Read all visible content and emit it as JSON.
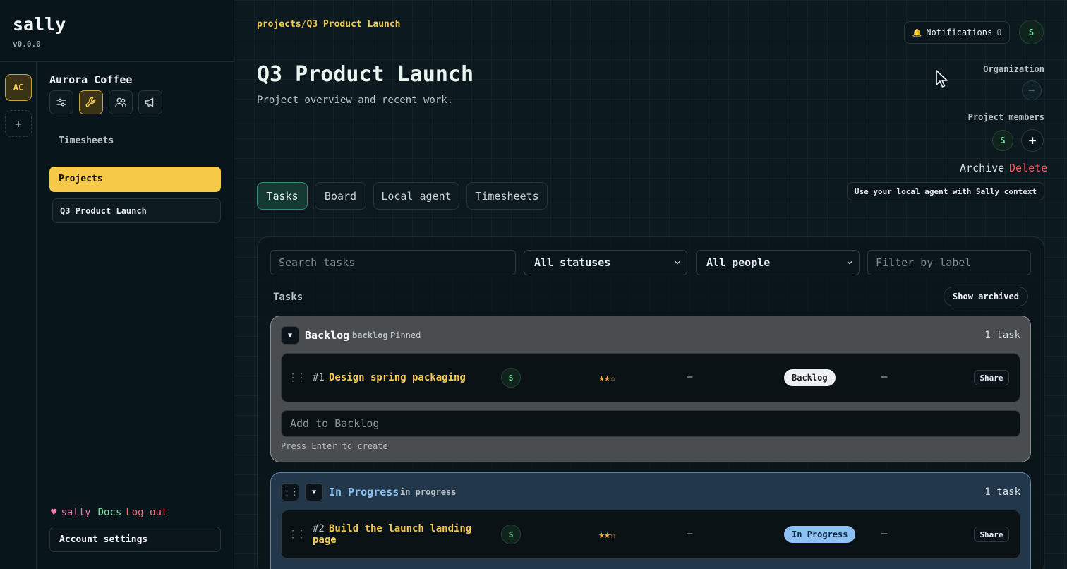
{
  "app": {
    "name": "sally",
    "version": "v0.0.0"
  },
  "org": {
    "avatar_initials": "AC",
    "name": "Aurora Coffee",
    "add_label": "+"
  },
  "sidebar": {
    "tools": [
      {
        "icon": "sliders-icon"
      },
      {
        "icon": "wrench-icon"
      },
      {
        "icon": "users-icon"
      },
      {
        "icon": "megaphone-icon"
      }
    ],
    "timesheets_label": "Timesheets",
    "projects_label": "Projects",
    "current_project": "Q3 Product Launch",
    "footer": {
      "heart": "♥",
      "sally": "sally",
      "docs": "Docs",
      "logout": "Log out"
    },
    "account_settings": "Account settings"
  },
  "header": {
    "breadcrumb_root": "projects",
    "breadcrumb_sep": "/",
    "breadcrumb_current": "Q3 Product Launch",
    "title": "Q3 Product Launch",
    "subtitle": "Project overview and recent work.",
    "notifications_icon": "🔔",
    "notifications_label": "Notifications",
    "notifications_count": "0",
    "user_initial": "S"
  },
  "meta": {
    "organization_label": "Organization",
    "organization_value": "–",
    "members_label": "Project members",
    "member_initial": "S",
    "add_member": "+",
    "archive_label": "Archive",
    "delete_label": "Delete",
    "local_agent_label": "Use your local agent with Sally context"
  },
  "tabs": [
    {
      "label": "Tasks",
      "active": true
    },
    {
      "label": "Board"
    },
    {
      "label": "Local agent"
    },
    {
      "label": "Timesheets"
    }
  ],
  "filters": {
    "search_placeholder": "Search tasks",
    "status_value": "All statuses",
    "people_value": "All people",
    "label_placeholder": "Filter by label"
  },
  "tasks_section": {
    "label": "Tasks",
    "show_archived": "Show archived"
  },
  "groups": [
    {
      "title": "Backlog",
      "key": "backlog",
      "pinned": "Pinned",
      "count": "1 task",
      "toggle": "▼",
      "tasks": [
        {
          "number": "#1",
          "title": "Design spring packaging",
          "assignee": "S",
          "rating": 2,
          "rating_max": 3,
          "stars": "★★☆",
          "due": "–",
          "status": "Backlog",
          "label": "–",
          "share": "Share"
        }
      ],
      "add_placeholder": "Add to Backlog",
      "hint": "Press Enter to create"
    },
    {
      "title": "In Progress",
      "key": "in progress",
      "count": "1 task",
      "toggle": "▼",
      "handle": "⠿",
      "tasks": [
        {
          "number": "#2",
          "title": "Build the launch landing page",
          "assignee": "S",
          "rating": 2,
          "rating_max": 3,
          "stars": "★★☆",
          "due": "–",
          "status": "In Progress",
          "label": "–",
          "share": "Share"
        }
      ]
    }
  ],
  "colors": {
    "accent_yellow": "#f7c948",
    "teal_active": "#3c8a73",
    "delete_red": "#f2555f",
    "progress_blue": "#8ec2f5"
  }
}
